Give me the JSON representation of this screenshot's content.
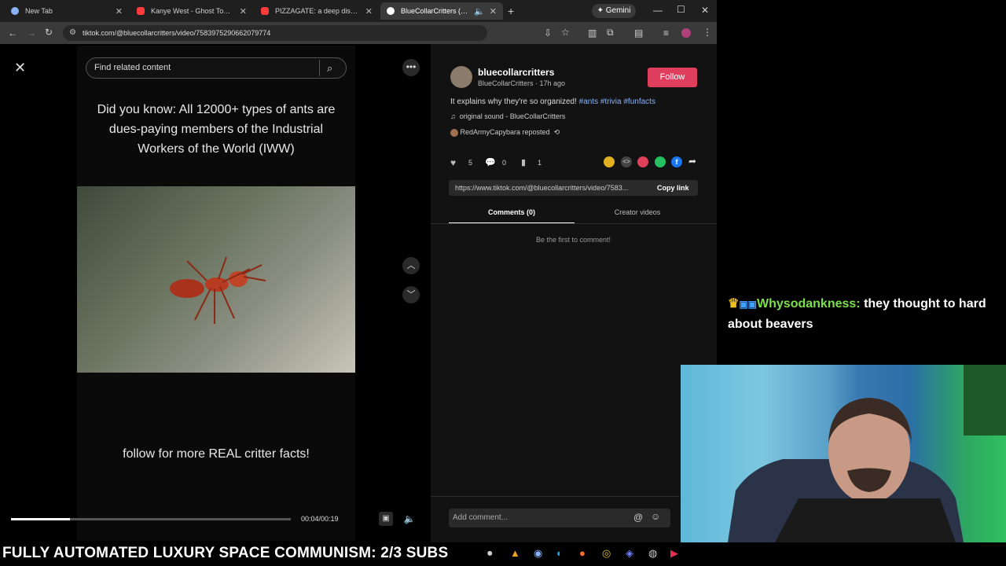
{
  "tabs": [
    {
      "label": "New Tab",
      "icon": "chrome-icon",
      "color": "#8ab4f8"
    },
    {
      "label": "Kanye West - Ghost Town but it...",
      "icon": "youtube-icon",
      "color": "#ff3b3b"
    },
    {
      "label": "PIZZAGATE: a deep dish - YouTu...",
      "icon": "youtube-icon",
      "color": "#ff3b3b"
    },
    {
      "label": "BlueCollarCritters (@bluec...",
      "icon": "tiktok-icon",
      "color": "#ffffff"
    }
  ],
  "gemini_label": "Gemini",
  "url": "tiktok.com/@bluecollarcritters/video/7583975290662079774",
  "search": {
    "placeholder": "Find related content"
  },
  "video": {
    "caption_top": "Did you know: All 12000+ types of ants are dues-paying members of the Industrial Workers of the World (IWW)",
    "caption_bottom": "follow for more REAL critter facts!",
    "time": "00:04/00:19",
    "progress": 0.21
  },
  "author": {
    "username": "bluecollarcritters",
    "display": "BlueCollarCritters · 17h ago",
    "follow_label": "Follow"
  },
  "description": {
    "text": "It explains why they're so organized! ",
    "tags": "#ants #trivia #funfacts"
  },
  "sound": "original sound - BlueCollarCritters",
  "repost": "RedArmyCapybara reposted",
  "stats": {
    "likes": "5",
    "comments": "0",
    "saves": "1"
  },
  "link": {
    "url": "https://www.tiktok.com/@bluecollarcritters/video/7583...",
    "copy_label": "Copy link"
  },
  "tabs_panel": {
    "comments": "Comments (0)",
    "creator": "Creator videos"
  },
  "empty_comments": "Be the first to comment!",
  "comment_placeholder": "Add comment...",
  "chat": {
    "user": "Whysodankness:",
    "message": " they thought to hard about beavers",
    "user_color": "#7ce04a"
  },
  "ticker": "FULLY AUTOMATED LUXURY SPACE COMMUNISM: 2/3 SUBS"
}
